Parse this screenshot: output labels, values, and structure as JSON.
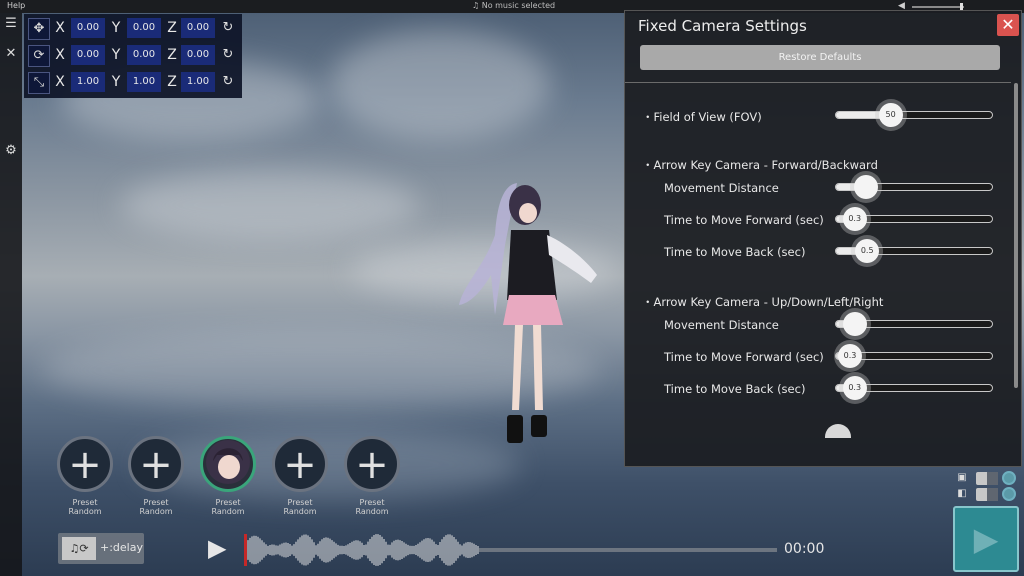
{
  "menu": {
    "help": "Help"
  },
  "music": {
    "label": "No music selected",
    "icon": "music-note-icon"
  },
  "transform": {
    "rows": [
      {
        "icon": "move-icon",
        "x_label": "X",
        "y_label": "Y",
        "z_label": "Z",
        "x": "0.00",
        "y": "0.00",
        "z": "0.00"
      },
      {
        "icon": "rotate-icon",
        "x_label": "X",
        "y_label": "Y",
        "z_label": "Z",
        "x": "0.00",
        "y": "0.00",
        "z": "0.00"
      },
      {
        "icon": "scale-icon",
        "x_label": "X",
        "y_label": "Y",
        "z_label": "Z",
        "x": "1.00",
        "y": "1.00",
        "z": "1.00"
      }
    ]
  },
  "panel": {
    "title": "Fixed Camera Settings",
    "restore_label": "Restore Defaults",
    "fov": {
      "label": "・Field of View (FOV)",
      "value": "50",
      "fraction": 0.35
    },
    "section1": {
      "title": "・Arrow Key Camera - Forward/Backward",
      "movement": {
        "label": "Movement Distance",
        "value": "",
        "fraction": 0.19
      },
      "forward": {
        "label": "Time to Move Forward (sec)",
        "value": "0.3",
        "fraction": 0.12
      },
      "back": {
        "label": "Time to Move Back (sec)",
        "value": "0.5",
        "fraction": 0.2
      }
    },
    "section2": {
      "title": "・Arrow Key Camera - Up/Down/Left/Right",
      "movement": {
        "label": "Movement Distance",
        "value": "",
        "fraction": 0.12
      },
      "forward": {
        "label": "Time to Move Forward (sec)",
        "value": "0.3",
        "fraction": 0.09
      },
      "back": {
        "label": "Time to Move Back (sec)",
        "value": "0.3",
        "fraction": 0.12
      }
    }
  },
  "presets": [
    {
      "line1": "Preset",
      "line2": "Random",
      "selected": false
    },
    {
      "line1": "Preset",
      "line2": "Random",
      "selected": false
    },
    {
      "line1": "Preset",
      "line2": "Random",
      "selected": true
    },
    {
      "line1": "Preset",
      "line2": "Random",
      "selected": false
    },
    {
      "line1": "Preset",
      "line2": "Random",
      "selected": false
    }
  ],
  "playback": {
    "delay_label": "+:delay",
    "time": "00:00",
    "progress": 0.44
  },
  "colors": {
    "accent": "#2d8a92",
    "close": "#d9534f",
    "transform_value_bg": "#1a2b78"
  }
}
